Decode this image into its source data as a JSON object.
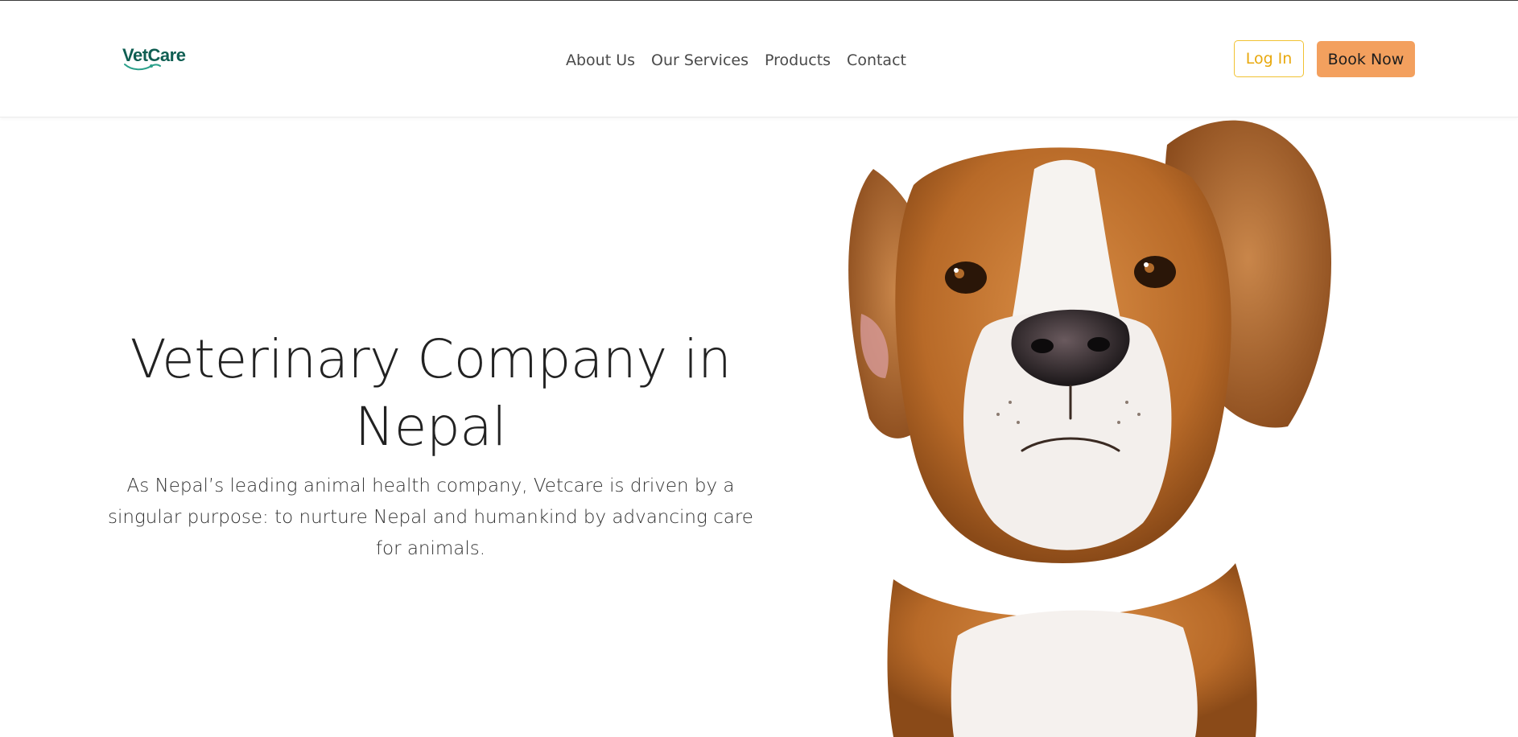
{
  "brand": {
    "logo_text": "VetCare"
  },
  "nav": {
    "items": [
      {
        "label": "About Us"
      },
      {
        "label": "Our Services"
      },
      {
        "label": "Products"
      },
      {
        "label": "Contact"
      }
    ]
  },
  "actions": {
    "login_label": "Log In",
    "book_label": "Book Now"
  },
  "hero": {
    "title": "Veterinary Company in Nepal",
    "description": "As Nepal’s leading animal health company, Vetcare is driven by a singular purpose: to nurture Nepal and humankind by advancing care for animals.",
    "image_subject": "beagle-dog-photo"
  },
  "colors": {
    "brand_green": "#0f5e52",
    "login_border": "#f1c232",
    "login_text": "#e8a80c",
    "book_bg": "#f3a05e",
    "text_dark": "#222222"
  }
}
